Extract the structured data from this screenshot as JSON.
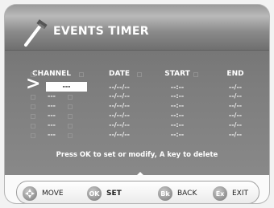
{
  "header": {
    "title": "EVENTS TIMER",
    "icon": "wand-icon"
  },
  "columns": [
    "CHANNEL",
    "DATE",
    "START",
    "END"
  ],
  "rows": [
    {
      "channel": "---",
      "date": "--/--/--",
      "start": "--:--",
      "end": "--/--"
    },
    {
      "channel": "---",
      "date": "--/--/--",
      "start": "--:--",
      "end": "--/--"
    },
    {
      "channel": "---",
      "date": "--/--/--",
      "start": "--:--",
      "end": "--/--"
    },
    {
      "channel": "---",
      "date": "--/--/--",
      "start": "--:--",
      "end": "--/--"
    },
    {
      "channel": "---",
      "date": "--/--/--",
      "start": "--:--",
      "end": "--/--"
    },
    {
      "channel": "---",
      "date": "--/--/--",
      "start": "--:--",
      "end": "--/--"
    }
  ],
  "hint": "Press OK to set or modify, A key to delete",
  "footer": [
    {
      "badge": "",
      "label": "MOVE",
      "icon": "dpad-icon"
    },
    {
      "badge": "OK",
      "label": "SET"
    },
    {
      "badge": "Bk",
      "label": "BACK"
    },
    {
      "badge": "Ex",
      "label": "EXIT"
    }
  ]
}
